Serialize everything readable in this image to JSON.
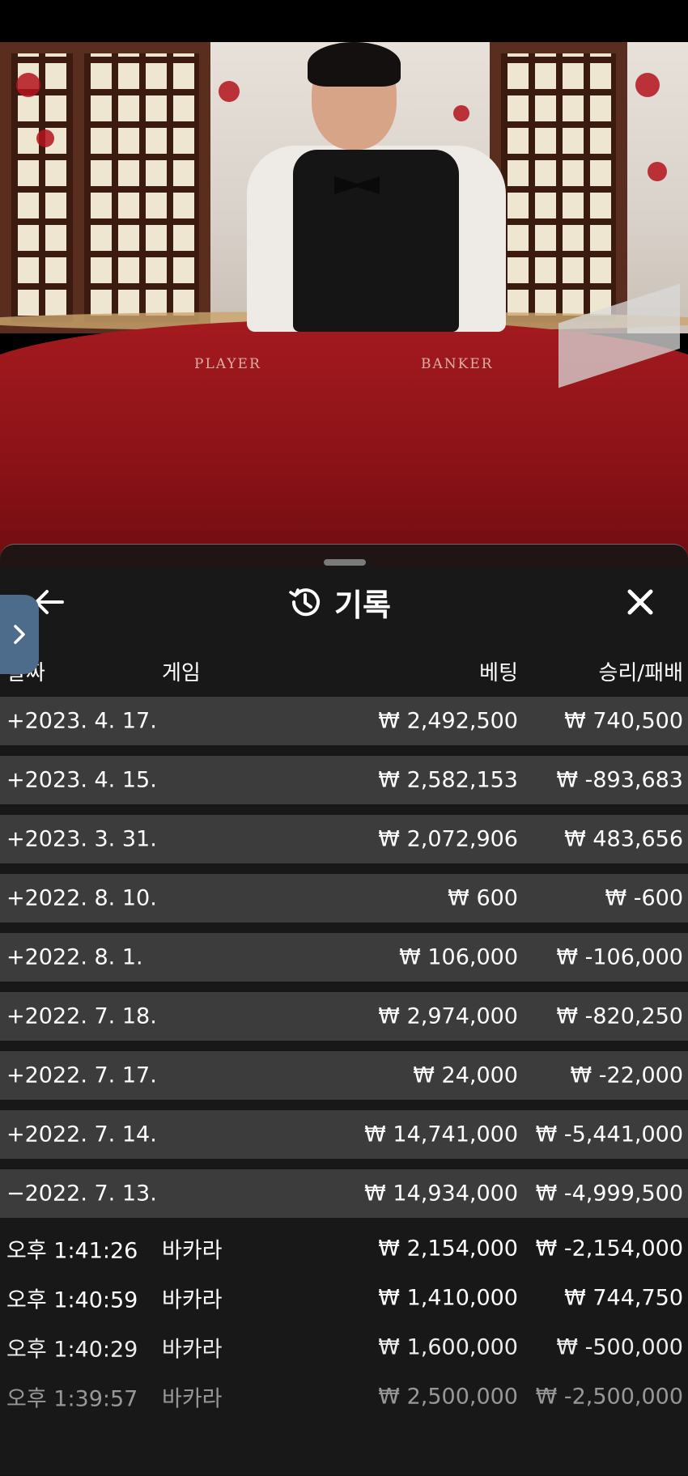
{
  "scene": {
    "table_labels": [
      "PLAYER",
      "BANKER"
    ]
  },
  "panel": {
    "title": "기록",
    "columns": {
      "date": "날짜",
      "game": "게임",
      "bet": "베팅",
      "win_loss": "승리/패배"
    },
    "day_rows": [
      {
        "date": "+2023. 4. 17.",
        "bet": "₩ 2,492,500",
        "win_loss": "₩ 740,500"
      },
      {
        "date": "+2023. 4. 15.",
        "bet": "₩ 2,582,153",
        "win_loss": "₩ -893,683"
      },
      {
        "date": "+2023. 3. 31.",
        "bet": "₩ 2,072,906",
        "win_loss": "₩ 483,656"
      },
      {
        "date": "+2022. 8. 10.",
        "bet": "₩ 600",
        "win_loss": "₩ -600"
      },
      {
        "date": "+2022. 8. 1.",
        "bet": "₩ 106,000",
        "win_loss": "₩ -106,000"
      },
      {
        "date": "+2022. 7. 18.",
        "bet": "₩ 2,974,000",
        "win_loss": "₩ -820,250"
      },
      {
        "date": "+2022. 7. 17.",
        "bet": "₩ 24,000",
        "win_loss": "₩ -22,000"
      },
      {
        "date": "+2022. 7. 14.",
        "bet": "₩ 14,741,000",
        "win_loss": "₩ -5,441,000"
      },
      {
        "date": "−2022. 7. 13.",
        "bet": "₩ 14,934,000",
        "win_loss": "₩ -4,999,500"
      }
    ],
    "game_rows": [
      {
        "time": "오후 1:41:26",
        "game": "바카라",
        "bet": "₩ 2,154,000",
        "win_loss": "₩ -2,154,000"
      },
      {
        "time": "오후 1:40:59",
        "game": "바카라",
        "bet": "₩ 1,410,000",
        "win_loss": "₩ 744,750"
      },
      {
        "time": "오후 1:40:29",
        "game": "바카라",
        "bet": "₩ 1,600,000",
        "win_loss": "₩ -500,000"
      },
      {
        "time": "오후 1:39:57",
        "game": "바카라",
        "bet": "₩ 2,500,000",
        "win_loss": "₩ -2,500,000"
      }
    ]
  },
  "colors": {
    "day_row_bg": "#3c3c3c",
    "side_tab": "#4d6c8c",
    "panel_bg": "#161616"
  },
  "icons": {
    "back": "arrow-left-icon",
    "history": "history-clock-icon",
    "close": "close-icon",
    "side_tab": "chevron-right-icon"
  }
}
